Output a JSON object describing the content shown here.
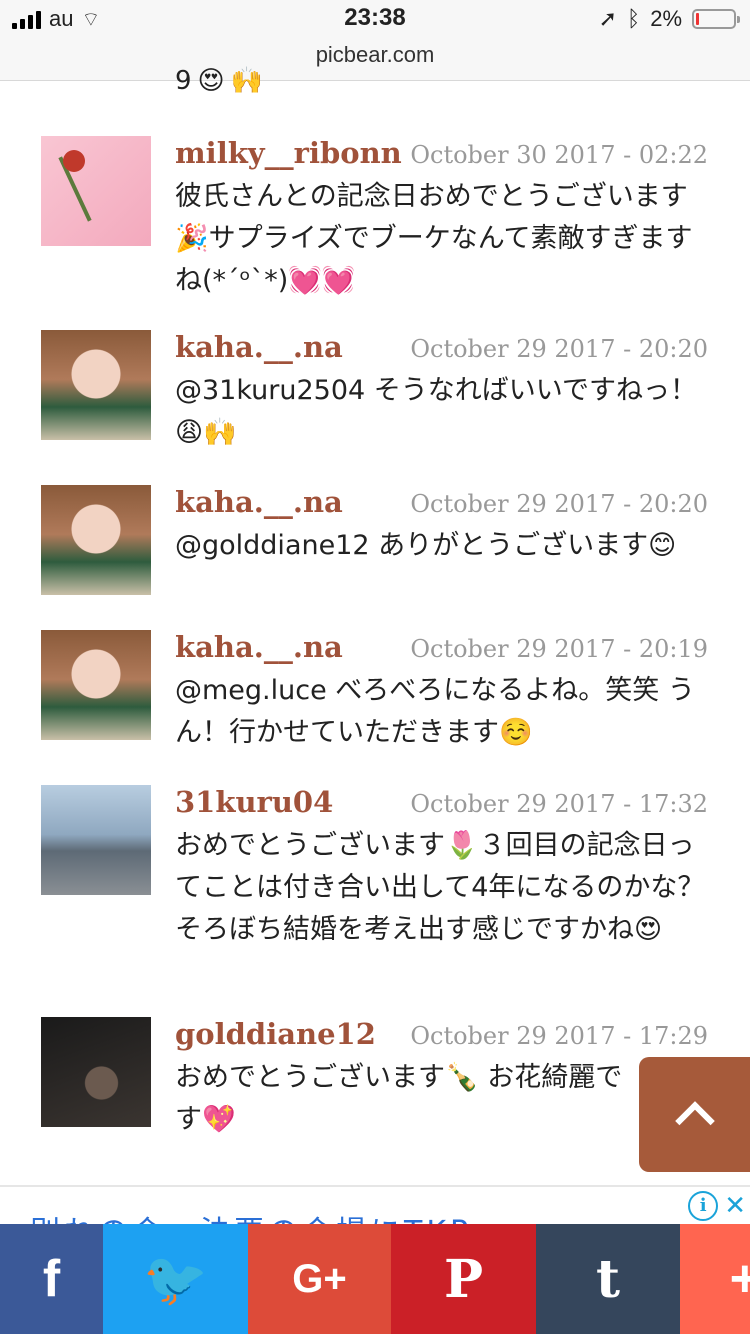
{
  "statusbar": {
    "carrier": "au",
    "time": "23:38",
    "url": "picbear.com",
    "battery": "2%"
  },
  "partial_comment": {
    "text": "9",
    "emojis": [
      "😍",
      "🙌"
    ]
  },
  "comments": [
    {
      "username": "milky__ribonn",
      "date": "October 30 2017 - 02:22",
      "text": "彼氏さんとの記念日おめでとうございます🎉サプライズでブーケなんて素敵すぎますね(*´ᵒ`*)💓💓"
    },
    {
      "username": "kaha.__.na",
      "date": "October 29 2017 - 20:20",
      "text": "@31kuru2504 そうなればいいですねっ！😩🙌"
    },
    {
      "username": "kaha.__.na",
      "date": "October 29 2017 - 20:20",
      "text": "@golddiane12 ありがとうございます😊"
    },
    {
      "username": "kaha.__.na",
      "date": "October 29 2017 - 20:19",
      "text": "@meg.luce べろべろになるよね。笑笑 うん！行かせていただきます☺️"
    },
    {
      "username": "31kuru04",
      "date": "October 29 2017 - 17:32",
      "text": "おめでとうございます🌷３回目の記念日ってことは付き合い出して4年になるのかな？そろぼち結婚を考え出す感じですかね😍"
    },
    {
      "username": "golddiane12",
      "date": "October 29 2017 - 17:29",
      "text": "おめでとうございます🍾 お花綺麗です💖"
    }
  ],
  "ad": {
    "text": "別れの会、法要の会場にTKP"
  },
  "share": [
    {
      "label": "f",
      "color": "#3b5998",
      "icon": "facebook-icon"
    },
    {
      "label": "🐦",
      "color": "#1da1f2",
      "icon": "twitter-icon"
    },
    {
      "label": "G+",
      "color": "#dd4b39",
      "icon": "google-plus-icon"
    },
    {
      "label": "P",
      "color": "#cb2027",
      "icon": "pinterest-icon"
    },
    {
      "label": "t",
      "color": "#35465c",
      "icon": "tumblr-icon"
    },
    {
      "label": "+",
      "color": "#ff6550",
      "icon": "more-share-icon"
    }
  ]
}
